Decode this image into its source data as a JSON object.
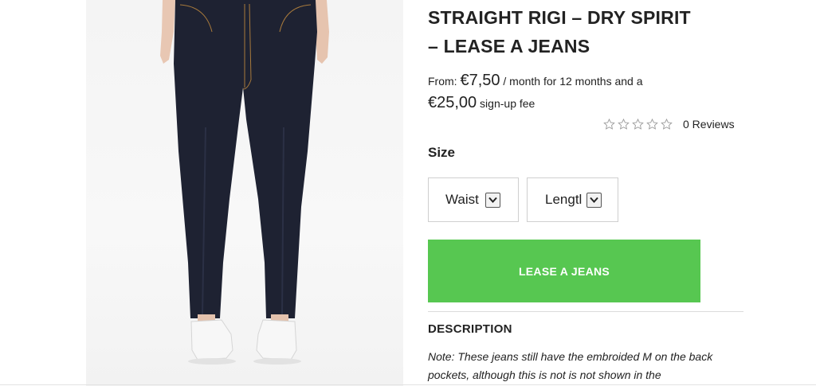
{
  "product": {
    "title_line1": "STRAIGHT RIGI – DRY SPIRIT",
    "title_line2": "– LEASE A JEANS"
  },
  "price": {
    "from_label": "From:",
    "monthly_amount": "€7,50",
    "monthly_suffix": " / month for 12 months and a",
    "signup_amount": "€25,00",
    "signup_suffix": " sign-up fee"
  },
  "rating": {
    "stars_filled": 0,
    "stars_total": 5,
    "reviews_label": "0 Reviews"
  },
  "size": {
    "label": "Size",
    "waist_value": "Waist",
    "length_value": "Lengtl"
  },
  "cta": {
    "label": "LEASE A JEANS"
  },
  "description": {
    "heading": "DESCRIPTION",
    "text": "Note: These jeans still have the embroided M on the back pockets, although this is not is not shown in the"
  },
  "colors": {
    "cta_green": "#57c751",
    "denim": "#1e2232",
    "text": "#222222"
  },
  "icons": [
    "star-icon",
    "chevron-down-icon"
  ]
}
